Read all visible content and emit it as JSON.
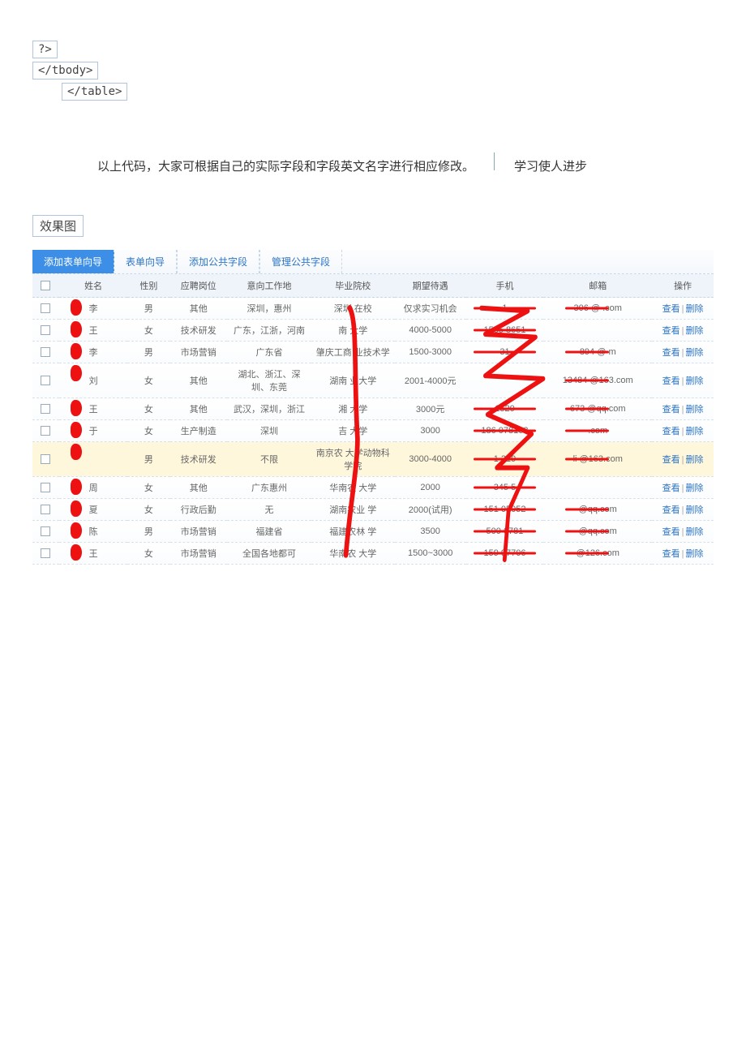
{
  "code_lines": [
    "?>",
    "</tbody>",
    "</table>"
  ],
  "description_main": "以上代码，大家可根据自己的实际字段和字段英文名字进行相应修改。",
  "description_aside": "学习使人进步",
  "section_title": "效果图",
  "tabs": [
    "添加表单向导",
    "表单向导",
    "添加公共字段",
    "管理公共字段"
  ],
  "active_tab_index": 0,
  "table": {
    "headers": [
      "",
      "姓名",
      "性别",
      "应聘岗位",
      "意向工作地",
      "毕业院校",
      "期望待遇",
      "手机",
      "邮箱",
      "操作"
    ],
    "ops": {
      "view": "查看",
      "del": "删除"
    },
    "rows": [
      {
        "name": "李",
        "gender": "男",
        "post": "其他",
        "area": "深圳，惠州",
        "school": "深圳  在校",
        "salary": "仅求实习机会",
        "phone": "           1",
        "email": "306       @  .com",
        "hl": false
      },
      {
        "name": "王",
        "gender": "女",
        "post": "技术研发",
        "area": "广东，江浙，河南",
        "school": "南    大学",
        "salary": "4000-5000",
        "phone": "1535   8651",
        "email": "",
        "hl": false
      },
      {
        "name": "李",
        "gender": "男",
        "post": "市场营销",
        "area": "广东省",
        "school": "肇庆工商 业技术学  ",
        "salary": "1500-3000",
        "phone": "        31",
        "email": "894       @   m",
        "hl": false
      },
      {
        "name": "刘",
        "gender": "女",
        "post": "其他",
        "area": "湖北、浙江、深圳、东莞",
        "school": "湖南  业大学",
        "salary": "2001-4000元",
        "phone": "",
        "email": "13484     @163.com",
        "hl": false
      },
      {
        "name": "王",
        "gender": "女",
        "post": "其他",
        "area": "武汉，深圳，浙江",
        "school": "湘  大学",
        "salary": "3000元",
        "phone": "1520",
        "email": "673      @qq.com",
        "hl": false
      },
      {
        "name": "于",
        "gender": "女",
        "post": "生产制造",
        "area": "深圳",
        "school": "吉  大学",
        "salary": "3000",
        "phone": "186  078103",
        "email": "        .com",
        "hl": false
      },
      {
        "name": "",
        "gender": "男",
        "post": "技术研发",
        "area": "不限",
        "school": "南京农  大学动物科  学院",
        "salary": "3000-4000",
        "phone": "1      219",
        "email": "li        @163.com",
        "hl": true
      },
      {
        "name": "周",
        "gender": "女",
        "post": "其他",
        "area": "广东惠州",
        "school": "华南农  大学",
        "salary": "2000",
        "phone": "  345    5",
        "email": "",
        "hl": false
      },
      {
        "name": "夏",
        "gender": "女",
        "post": "行政后勤",
        "area": "无",
        "school": "湖南农业  学",
        "salary": "2000(试用)",
        "phone": "151   05052",
        "email": "        @qq.com",
        "hl": false
      },
      {
        "name": "陈",
        "gender": "男",
        "post": "市场营销",
        "area": "福建省",
        "school": "福建农林  学",
        "salary": "3500",
        "phone": "   500  6781",
        "email": "        @qq.com",
        "hl": false
      },
      {
        "name": "王",
        "gender": "女",
        "post": "市场营销",
        "area": "全国各地都可",
        "school": "华南农  大学",
        "salary": "1500~3000",
        "phone": "159   97706",
        "email": "        @126.com",
        "hl": false
      }
    ]
  }
}
